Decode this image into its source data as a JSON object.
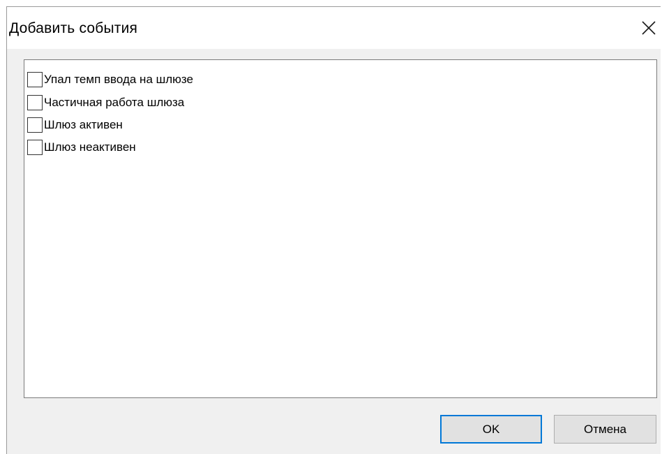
{
  "dialog": {
    "title": "Добавить события",
    "close_icon": "close-icon"
  },
  "events": [
    {
      "label": "Упал темп ввода на шлюзе",
      "checked": false
    },
    {
      "label": "Частичная работа шлюза",
      "checked": false
    },
    {
      "label": "Шлюз активен",
      "checked": false
    },
    {
      "label": "Шлюз неактивен",
      "checked": false
    }
  ],
  "buttons": {
    "ok_label": "OK",
    "cancel_label": "Отмена"
  },
  "colors": {
    "accent": "#0078d7",
    "dialog_bg": "#f0f0f0",
    "button_bg": "#e1e1e1"
  }
}
